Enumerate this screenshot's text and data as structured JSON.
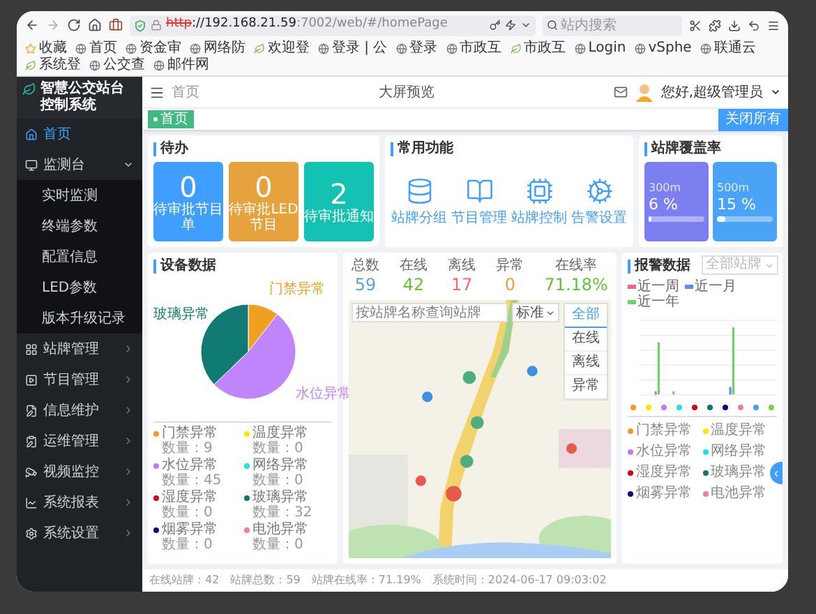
{
  "browser": {
    "url": {
      "protocol": "http",
      "host": "://192.168.21.59",
      "path": ":7002/web/#/homePage"
    },
    "search_placeholder": "站内搜索",
    "bookmarks": [
      "收藏",
      "首页",
      "资金审",
      "网络防",
      "欢迎登",
      "登录 | 公",
      "登录",
      "市政互",
      "市政互",
      "Login",
      "vSphe",
      "联通云",
      "系统登",
      "公交查",
      "邮件网"
    ]
  },
  "sidebar": {
    "title": "智慧公交站台控制系统",
    "items": [
      {
        "label": "首页",
        "selected": true
      },
      {
        "label": "监测台",
        "selected": false,
        "expanded": true,
        "children": [
          {
            "label": "实时监测"
          },
          {
            "label": "终端参数"
          },
          {
            "label": "配置信息"
          },
          {
            "label": "LED参数"
          },
          {
            "label": "版本升级记录"
          }
        ]
      },
      {
        "label": "站牌管理",
        "selected": false,
        "expanded": false
      },
      {
        "label": "节目管理",
        "selected": false,
        "expanded": false
      },
      {
        "label": "信息维护",
        "selected": false,
        "expanded": false
      },
      {
        "label": "运维管理",
        "selected": false,
        "expanded": false
      },
      {
        "label": "视频监控",
        "selected": false,
        "expanded": false
      },
      {
        "label": "系统报表",
        "selected": false,
        "expanded": false
      },
      {
        "label": "系统设置",
        "selected": false,
        "expanded": false
      }
    ]
  },
  "header": {
    "breadcrumb": "首页",
    "center_link": "大屏预览",
    "user": "您好,超级管理员"
  },
  "tabs": [
    {
      "label": "首页",
      "selected": true
    }
  ],
  "close_all_button": "关闭所有",
  "todo": {
    "title": "待办",
    "tiles": [
      {
        "value": "0",
        "label": "待审批节目单",
        "color": "#409eff"
      },
      {
        "value": "0",
        "label": "待审批LED节目",
        "color": "#e6a23c"
      },
      {
        "value": "2",
        "label": "待审批通知",
        "color": "#13c2b3"
      }
    ]
  },
  "shortcuts": {
    "title": "常用功能",
    "items": [
      "站牌分组",
      "节目管理",
      "站牌控制",
      "告警设置"
    ]
  },
  "coverage": {
    "title": "站牌覆盖率",
    "tiles": [
      {
        "radius": "300m",
        "value": "6 %",
        "level": 0.06,
        "color": "#7b7ff0"
      },
      {
        "radius": "500m",
        "value": "15 %",
        "level": 0.15,
        "color": "#4aa3f5"
      }
    ]
  },
  "device": {
    "title": "设备数据",
    "chart_data": {
      "type": "pie",
      "categories": [
        "门禁异常",
        "水位异常",
        "玻璃异常"
      ],
      "values": [
        10.5,
        52.3,
        37.2
      ],
      "colors": [
        "#f0a020",
        "#c084fc",
        "#0f7b72"
      ]
    },
    "legend": [
      {
        "label": "门禁异常",
        "count": "数量：9",
        "color": "#f59a23"
      },
      {
        "label": "温度异常",
        "count": "数量：0",
        "color": "#ffe600"
      },
      {
        "label": "水位异常",
        "count": "数量：45",
        "color": "#b57cf5"
      },
      {
        "label": "网络异常",
        "count": "数量：0",
        "color": "#1ee0f0"
      },
      {
        "label": "湿度异常",
        "count": "数量：0",
        "color": "#d0021b"
      },
      {
        "label": "玻璃异常",
        "count": "数量：32",
        "color": "#0a7a6e"
      },
      {
        "label": "烟雾异常",
        "count": "数量：0",
        "color": "#0a0a80"
      },
      {
        "label": "电池异常",
        "count": "数量：0",
        "color": "#f08090"
      }
    ]
  },
  "stats": [
    {
      "label": "总数",
      "value": "59",
      "color": "#5aa0e6"
    },
    {
      "label": "在线",
      "value": "42",
      "color": "#67c23a"
    },
    {
      "label": "离线",
      "value": "17",
      "color": "#f56c6c"
    },
    {
      "label": "异常",
      "value": "0",
      "color": "#e6a23c"
    },
    {
      "label": "在线率",
      "value": "71.18%",
      "color": "#67c23a"
    }
  ],
  "map": {
    "search_placeholder": "按站牌名称查询站牌",
    "style_select": "标准",
    "filters": [
      {
        "label": "全部",
        "selected": true
      },
      {
        "label": "在线",
        "selected": false
      },
      {
        "label": "离线",
        "selected": false
      },
      {
        "label": "异常",
        "selected": false
      }
    ]
  },
  "alarm": {
    "title": "报警数据",
    "select": "全部站牌",
    "series": [
      {
        "name": "近一周",
        "color": "#f06292"
      },
      {
        "name": "近一月",
        "color": "#5b8def"
      },
      {
        "name": "近一年",
        "color": "#6cd36c"
      }
    ],
    "dots": [
      {
        "color": "#f59a23"
      },
      {
        "color": "#ffe600"
      },
      {
        "color": "#b57cf5"
      },
      {
        "color": "#1ee0f0"
      },
      {
        "color": "#d0021b"
      },
      {
        "color": "#0a7a6e"
      },
      {
        "color": "#0a0a80"
      },
      {
        "color": "#f08090"
      },
      {
        "color": "#4a9cf5"
      },
      {
        "color": "#7ccf3a"
      }
    ],
    "legend": [
      {
        "label": "门禁异常",
        "color": "#f59a23"
      },
      {
        "label": "温度异常",
        "color": "#ffe600"
      },
      {
        "label": "水位异常",
        "color": "#b57cf5"
      },
      {
        "label": "网络异常",
        "color": "#1ee0f0"
      },
      {
        "label": "湿度异常",
        "color": "#d0021b"
      },
      {
        "label": "玻璃异常",
        "color": "#0a7a6e"
      },
      {
        "label": "烟雾异常",
        "color": "#0a0a80"
      },
      {
        "label": "电池异常",
        "color": "#f08090"
      }
    ]
  },
  "footer": [
    "在线站牌：42",
    "站牌总数：59",
    "站牌在线率：71.19%",
    "系统时间：2024-06-17 09:03:02"
  ]
}
